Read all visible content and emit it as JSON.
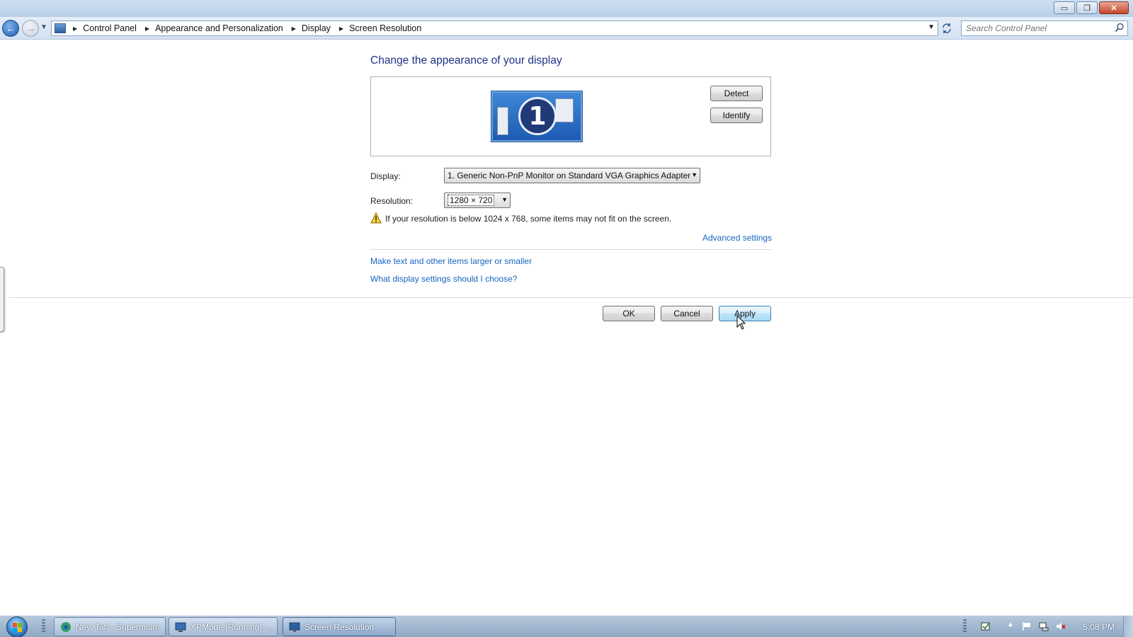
{
  "window": {
    "minimize_glyph": "▭",
    "maximize_glyph": "❐",
    "close_glyph": "✕"
  },
  "address_bar": {
    "breadcrumbs": [
      "Control Panel",
      "Appearance and Personalization",
      "Display",
      "Screen Resolution"
    ],
    "search_placeholder": "Search Control Panel"
  },
  "main": {
    "title": "Change the appearance of your display",
    "monitor_number": "1",
    "detect_label": "Detect",
    "identify_label": "Identify",
    "display_label": "Display:",
    "display_value": "1. Generic Non-PnP Monitor on Standard VGA Graphics Adapter",
    "resolution_label": "Resolution:",
    "resolution_value": "1280 × 720",
    "warning_text": "If your resolution is below 1024 x 768, some items may not fit on the screen.",
    "advanced_link": "Advanced settings",
    "links": [
      "Make text and other items larger or smaller",
      "What display settings should I choose?"
    ],
    "ok_label": "OK",
    "cancel_label": "Cancel",
    "apply_label": "Apply"
  },
  "taskbar": {
    "tasks": [
      "New Tab - Supermium",
      "XPMode [Running] -...",
      "Screen Resolution"
    ],
    "clock": "5:08 PM"
  },
  "colors": {
    "link": "#1565c0",
    "title": "#1e3287",
    "taskbar": "#8ea8c4"
  }
}
